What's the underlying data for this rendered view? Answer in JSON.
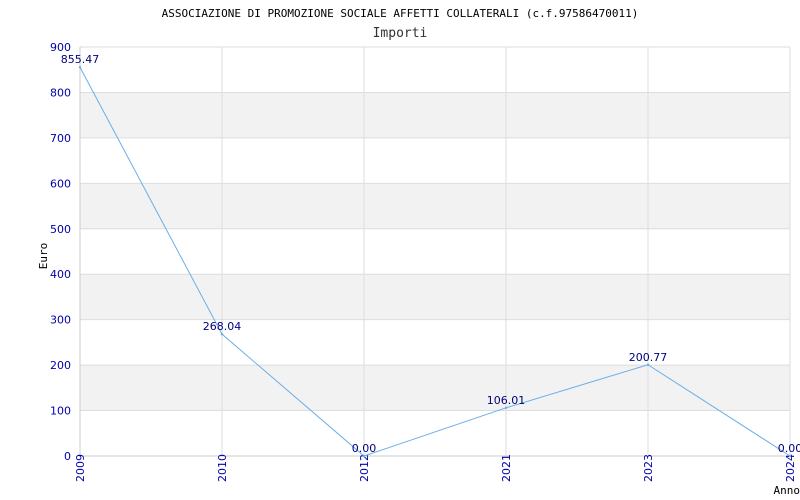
{
  "chart_data": {
    "type": "line",
    "title": "ASSOCIAZIONE DI PROMOZIONE SOCIALE AFFETTI COLLATERALI (c.f.97586470011)",
    "subtitle": "Importi",
    "xlabel": "Anno",
    "ylabel": "Euro",
    "categories": [
      "2009",
      "2010",
      "2012",
      "2021",
      "2023",
      "2024"
    ],
    "values": [
      855.47,
      268.04,
      0.0,
      106.01,
      200.77,
      0.0
    ],
    "value_labels": [
      "855.47",
      "268.04",
      "0.00",
      "106.01",
      "200.77",
      "0.00"
    ],
    "ylim": [
      0,
      900
    ],
    "yticks": [
      "0",
      "100",
      "200",
      "300",
      "400",
      "500",
      "600",
      "700",
      "800",
      "900"
    ],
    "grid": true,
    "legend": "none",
    "colors": {
      "line": "#6aaee8",
      "tick_text": "#0000aa",
      "value_label": "#000080",
      "band": "#f2f2f2",
      "grid": "#dddddd",
      "title": "#000000"
    }
  }
}
